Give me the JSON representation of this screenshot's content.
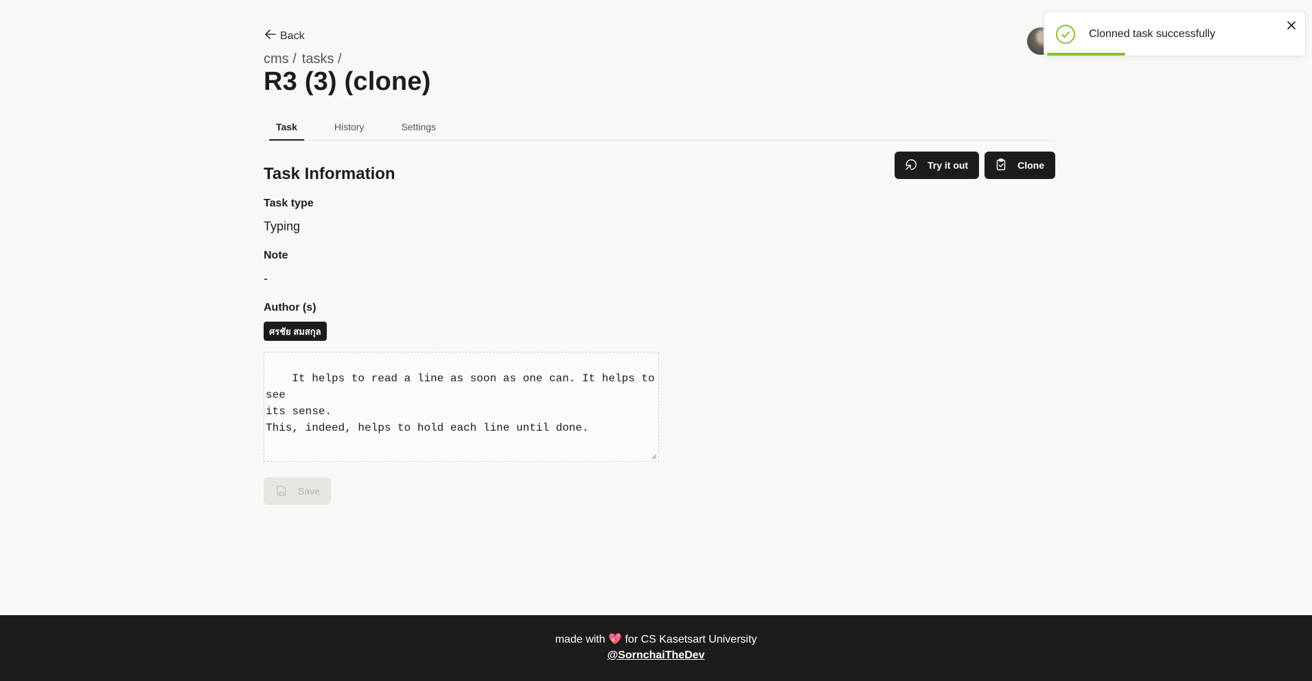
{
  "nav": {
    "back_label": "Back"
  },
  "breadcrumb": {
    "items": [
      "cms /",
      "tasks /"
    ]
  },
  "page_title": "R3 (3) (clone)",
  "tabs": [
    {
      "label": "Task",
      "active": true
    },
    {
      "label": "History",
      "active": false
    },
    {
      "label": "Settings",
      "active": false
    }
  ],
  "section": {
    "title": "Task Information",
    "try_label": "Try it out",
    "clone_label": "Clone"
  },
  "fields": {
    "task_type_label": "Task type",
    "task_type_value": "Typing",
    "note_label": "Note",
    "note_value": "-",
    "author_label": "Author (s)",
    "author_name": "ศรชัย สมสกุล"
  },
  "content": "It helps to read a line as soon as one can. It helps to see\nits sense.\nThis, indeed, helps to hold each line until done.",
  "save_label": "Save",
  "toast": {
    "message": "Clonned task successfully",
    "progress": 0.3,
    "accent": "#86c232"
  },
  "footer": {
    "pre": "made with",
    "heart": "💖",
    "post": "for CS Kasetsart University",
    "link": "@SornchaiTheDev"
  },
  "colors": {
    "dark": "#1c1c1a",
    "background": "#f8f8f6"
  }
}
